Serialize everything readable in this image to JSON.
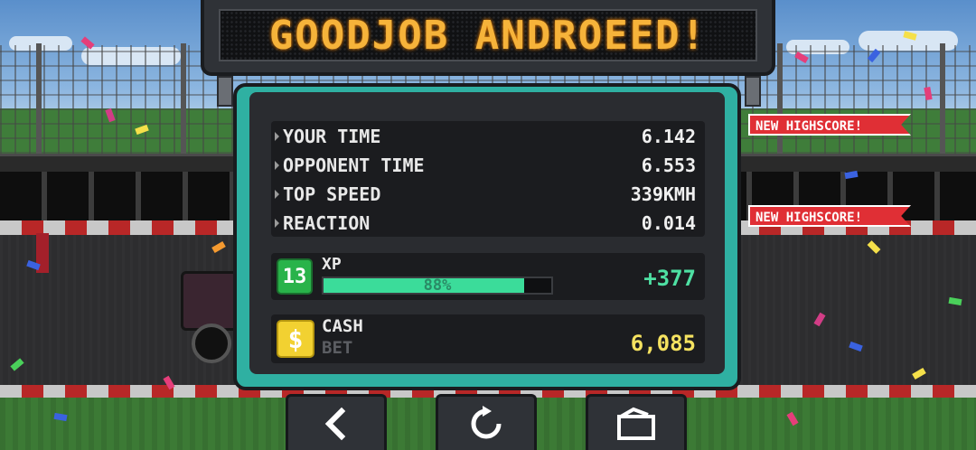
{
  "banner": {
    "text": "GOODJOB ANDROEED!"
  },
  "stats": [
    {
      "label": "YOUR TIME",
      "value": "6.142"
    },
    {
      "label": "OPPONENT TIME",
      "value": "6.553"
    },
    {
      "label": "TOP SPEED",
      "value": "339KMH"
    },
    {
      "label": "REACTION",
      "value": "0.014"
    }
  ],
  "highscore_tags": [
    "NEW HIGHSCORE!",
    "NEW HIGHSCORE!"
  ],
  "xp": {
    "level": "13",
    "label": "XP",
    "progress_label": "88%",
    "progress": 0.88,
    "gain": "+377"
  },
  "cash": {
    "icon": "$",
    "label": "CASH",
    "sublabel": "BET",
    "value": "6,085"
  },
  "buttons": [
    {
      "name": "back",
      "icon": "chevron-left-icon"
    },
    {
      "name": "restart",
      "icon": "restart-icon"
    },
    {
      "name": "video",
      "icon": "video-icon"
    }
  ],
  "colors": {
    "banner_text": "#f6b33a",
    "panel": "#2fb0a2",
    "xp_fill": "#3bdc9a",
    "cash_value": "#f5e260",
    "highscore": "#e02f35"
  }
}
